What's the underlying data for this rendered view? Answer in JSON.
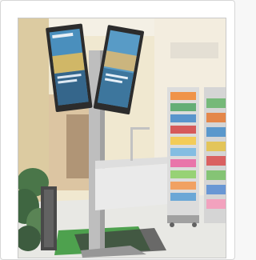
{
  "image": {
    "subject": "photo",
    "accent": "#1f6fb0",
    "floor_green": "#3f9a3f",
    "wall_cream": "#efe6cd",
    "pillar_beige": "#d8c79a"
  }
}
